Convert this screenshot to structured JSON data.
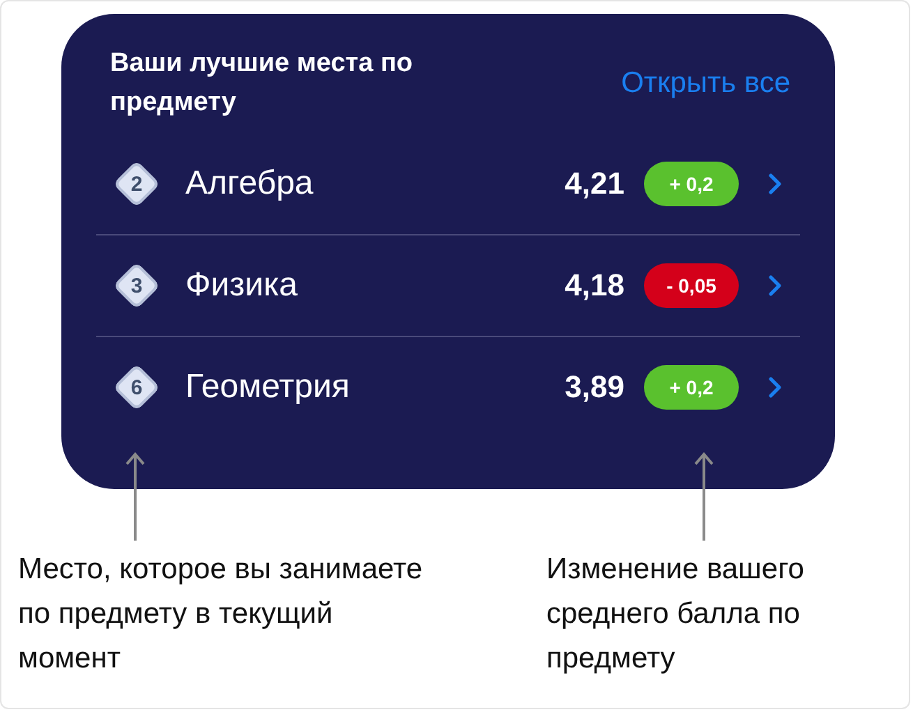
{
  "card": {
    "title": "Ваши лучшие места по предмету",
    "link": "Открыть все"
  },
  "subjects": [
    {
      "place": "2",
      "name": "Алгебра",
      "score": "4,21",
      "change": "+ 0,2",
      "color": "#5ac12e"
    },
    {
      "place": "3",
      "name": "Физика",
      "score": "4,18",
      "change": "- 0,05",
      "color": "#d4001a"
    },
    {
      "place": "6",
      "name": "Геометрия",
      "score": "3,89",
      "change": "+ 0,2",
      "color": "#5ac12e"
    }
  ],
  "callouts": [
    {
      "text": "Место, которое вы занимаете по предмету в текущий момент"
    },
    {
      "text": "Изменение вашего среднего балла по предмету"
    }
  ]
}
